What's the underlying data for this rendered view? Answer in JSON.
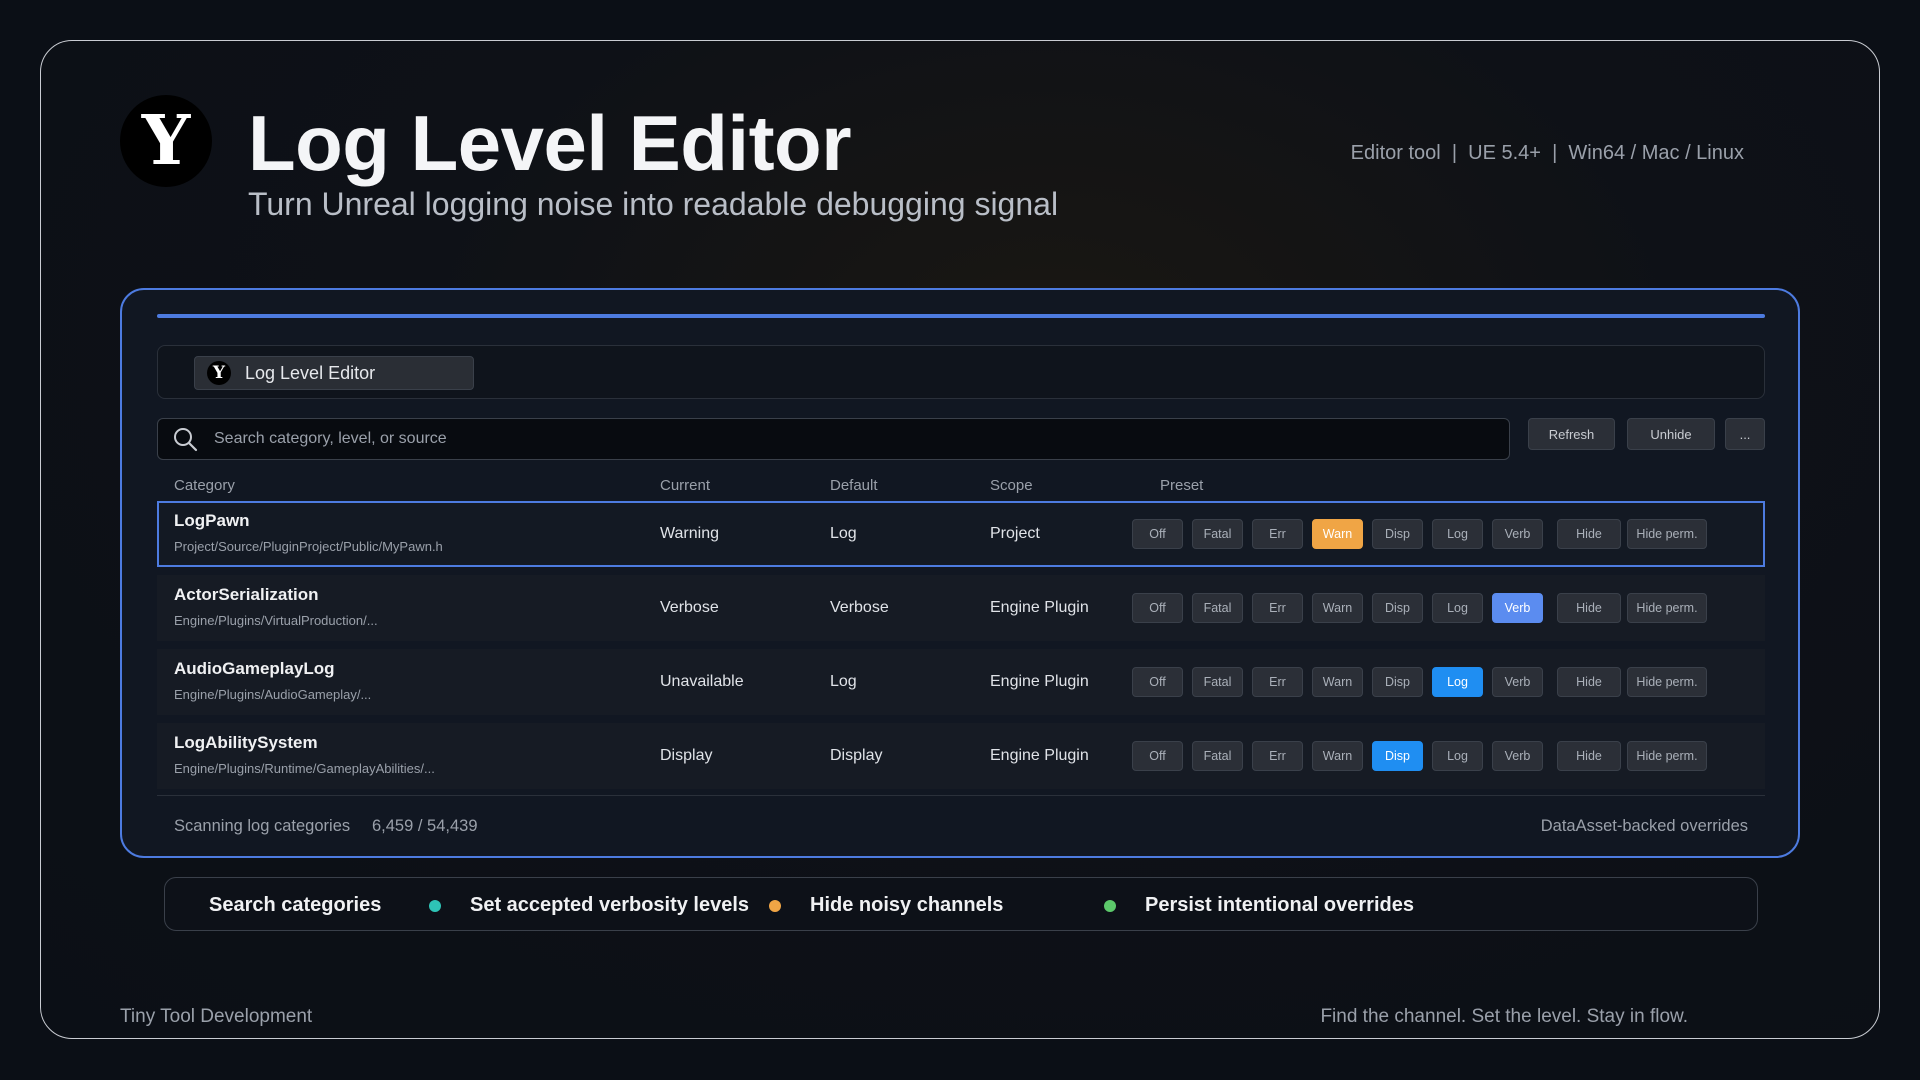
{
  "header": {
    "logo_letter": "Y",
    "title": "Log Level Editor",
    "subtitle": "Turn Unreal logging noise into readable debugging signal",
    "meta": "Editor tool  |  UE 5.4+  |  Win64 / Mac / Linux"
  },
  "panel": {
    "tab": {
      "logo_letter": "Y",
      "label": "Log Level Editor"
    },
    "search": {
      "placeholder": "Search category, level, or source",
      "value": ""
    },
    "toolbar_buttons": {
      "refresh": "Refresh",
      "unhide": "Unhide",
      "more": "..."
    },
    "columns": {
      "category": "Category",
      "current": "Current",
      "default": "Default",
      "scope": "Scope",
      "preset": "Preset"
    },
    "levels": [
      "Off",
      "Fatal",
      "Err",
      "Warn",
      "Disp",
      "Log",
      "Verb"
    ],
    "hide_labels": {
      "hide": "Hide",
      "hide_perm": "Hide perm."
    },
    "rows": [
      {
        "name": "LogPawn",
        "path": "Project/Source/PluginProject/Public/MyPawn.h",
        "current": "Warning",
        "default": "Log",
        "scope": "Project",
        "active_level": "Warn",
        "selected": true
      },
      {
        "name": "ActorSerialization",
        "path": "Engine/Plugins/VirtualProduction/...",
        "current": "Verbose",
        "default": "Verbose",
        "scope": "Engine Plugin",
        "active_level": "Verb",
        "selected": false
      },
      {
        "name": "AudioGameplayLog",
        "path": "Engine/Plugins/AudioGameplay/...",
        "current": "Unavailable",
        "default": "Log",
        "scope": "Engine Plugin",
        "active_level": "Log",
        "selected": false
      },
      {
        "name": "LogAbilitySystem",
        "path": "Engine/Plugins/Runtime/GameplayAbilities/...",
        "current": "Display",
        "default": "Display",
        "scope": "Engine Plugin",
        "active_level": "Disp",
        "selected": false
      }
    ],
    "status": {
      "scanning": "Scanning log categories",
      "count": "6,459 / 54,439",
      "right": "DataAsset-backed overrides"
    }
  },
  "features": [
    {
      "label": "Search categories",
      "dot_color": null
    },
    {
      "label": "Set accepted verbosity levels",
      "dot_color": "#2ec4b6"
    },
    {
      "label": "Hide noisy channels",
      "dot_color": "#f0a545"
    },
    {
      "label": "Persist intentional overrides",
      "dot_color": "#5cc96b"
    }
  ],
  "footer": {
    "left": "Tiny Tool Development",
    "right": "Find the channel. Set the level. Stay in flow."
  },
  "colors": {
    "accent": "#4d7be0",
    "warn": "#f0a545",
    "verb": "#5b8cf0",
    "log_disp": "#1f8ef2"
  }
}
